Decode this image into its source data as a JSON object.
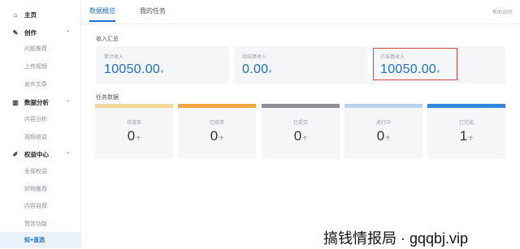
{
  "sidebar": {
    "items": [
      {
        "type": "main",
        "icon": "home-icon",
        "glyph": "⌂",
        "label": "主页",
        "chevron": ""
      },
      {
        "type": "main",
        "icon": "pen-icon",
        "glyph": "✎",
        "label": "创作",
        "chevron": "⌃"
      },
      {
        "type": "sub",
        "label": "问题推荐"
      },
      {
        "type": "sub",
        "label": "上传视频"
      },
      {
        "type": "sub",
        "label": "发布文章"
      },
      {
        "type": "main",
        "icon": "chart-icon",
        "glyph": "▥",
        "label": "数据分析",
        "chevron": "⌃"
      },
      {
        "type": "sub",
        "label": "内容分析"
      },
      {
        "type": "sub",
        "label": "视频收益"
      },
      {
        "type": "main",
        "icon": "pencil-icon",
        "glyph": "✐",
        "label": "权益中心",
        "chevron": "⌃"
      },
      {
        "type": "sub",
        "label": "全部权益"
      },
      {
        "type": "sub",
        "label": "好物推荐"
      },
      {
        "type": "sub",
        "label": "内容自荐"
      },
      {
        "type": "sub",
        "label": "赞赏功能"
      },
      {
        "type": "sub",
        "label": "知+直选",
        "active": true
      }
    ]
  },
  "tabs": {
    "items": [
      "数据概览",
      "我的任务"
    ],
    "active": 0,
    "help": "帮助说明"
  },
  "income": {
    "section_title": "收入汇总",
    "cards": [
      {
        "label": "累计收入",
        "value": "10050.00",
        "unit": "¥"
      },
      {
        "label": "待结算收入",
        "value": "0.00",
        "unit": "¥"
      },
      {
        "label": "已结算收入",
        "value": "10050.00",
        "unit": "¥",
        "highlighted": true
      }
    ],
    "highlight_color": "#d9483b"
  },
  "tasks": {
    "section_title": "任务数据",
    "cards": [
      {
        "label": "待接单",
        "value": "0",
        "unit": "个",
        "color": "#f3d89c"
      },
      {
        "label": "已接单",
        "value": "0",
        "unit": "个",
        "color": "#f0a63c"
      },
      {
        "label": "已提交",
        "value": "0",
        "unit": "个",
        "color": "#8f8f96"
      },
      {
        "label": "进行中",
        "value": "0",
        "unit": "个",
        "color": "#b9d3ee"
      },
      {
        "label": "已完成",
        "value": "1",
        "unit": "个",
        "color": "#2f88de"
      }
    ]
  },
  "watermark": "搞钱情报局 · gqqbj.vip",
  "colors": {
    "accent": "#1a6fd8",
    "active_bg": "#e9f2fd"
  }
}
